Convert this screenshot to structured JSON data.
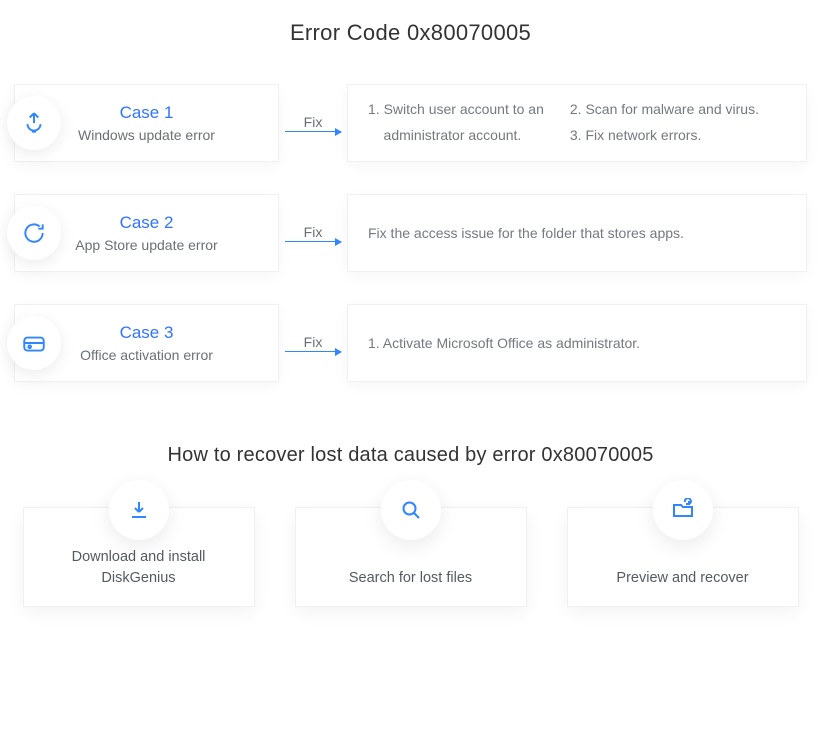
{
  "title": "Error Code 0x80070005",
  "fix_label": "Fix",
  "cases": [
    {
      "title": "Case 1",
      "subtitle": "Windows update error",
      "fixes_col1": [
        "1. Switch user account to an",
        "    administrator account."
      ],
      "fixes_col2": [
        "2. Scan for malware and virus.",
        "3. Fix network errors."
      ]
    },
    {
      "title": "Case 2",
      "subtitle": "App Store update error",
      "fix_text": "Fix the access issue for the folder that stores apps."
    },
    {
      "title": "Case 3",
      "subtitle": "Office activation error",
      "fix_text": "1. Activate Microsoft Office as administrator."
    }
  ],
  "recover_title": "How to recover lost data caused by error 0x80070005",
  "steps": [
    {
      "label": "Download and install DiskGenius"
    },
    {
      "label": "Search for lost files"
    },
    {
      "label": "Preview and recover"
    }
  ]
}
